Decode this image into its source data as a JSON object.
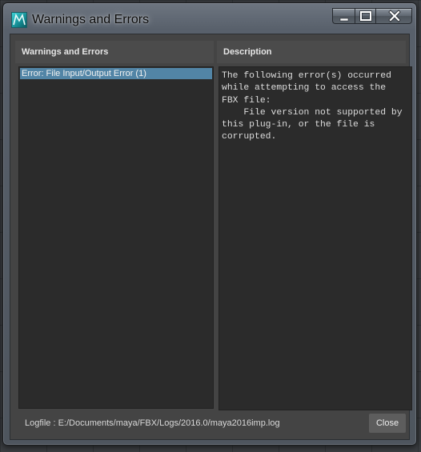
{
  "window": {
    "title": "Warnings and Errors",
    "app_icon": "maya-icon",
    "caption_buttons": [
      "minimize-icon",
      "maximize-icon",
      "close-icon"
    ]
  },
  "left_panel": {
    "header": "Warnings and Errors",
    "items": [
      {
        "label": "Error: File Input/Output Error (1)",
        "selected": true
      }
    ]
  },
  "right_panel": {
    "header": "Description",
    "text": "The following error(s) occurred\nwhile attempting to access the\nFBX file:\n    File version not supported by\nthis plug-in, or the file is\ncorrupted."
  },
  "footer": {
    "logfile": "Logfile : E:/Documents/maya/FBX/Logs/2016.0/maya2016imp.log",
    "close_label": "Close"
  },
  "colors": {
    "selection": "#5285a6",
    "panel_bg": "#2b2b2b",
    "dialog_bg": "#444444"
  }
}
